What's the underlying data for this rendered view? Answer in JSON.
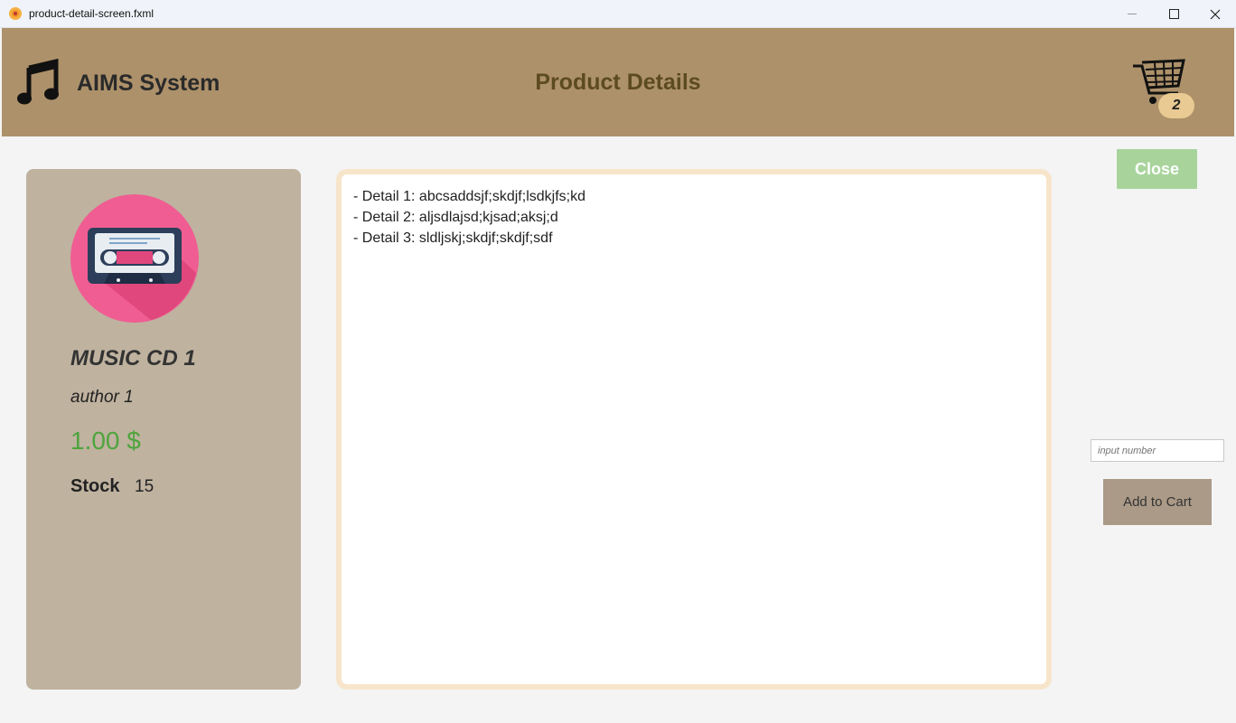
{
  "window": {
    "title": "product-detail-screen.fxml"
  },
  "header": {
    "app_name": "AIMS System",
    "page_title": "Product Details",
    "cart_count": "2",
    "icons": {
      "logo": "music-note-icon",
      "cart": "shopping-cart-icon"
    }
  },
  "product": {
    "name": "MUSIC CD 1",
    "author": "author 1",
    "price": "1.00 $",
    "stock_label": "Stock",
    "stock_value": "15",
    "image_icon": "cassette-tape-icon",
    "details": "- Detail 1: abcsaddsjf;skdjf;lsdkjfs;kd\n- Detail 2: aljsdlajsd;kjsad;aksj;d\n- Detail 3: sldljskj;skdjf;skdjf;sdf"
  },
  "actions": {
    "close_label": "Close",
    "quantity_placeholder": "input number",
    "add_to_cart_label": "Add to Cart"
  },
  "colors": {
    "header": "#ad916a",
    "card": "#bfb29f",
    "price": "#4ea43d",
    "close_button": "#a8d49c",
    "add_button": "#ab9a87",
    "badge": "#e8ca92"
  }
}
